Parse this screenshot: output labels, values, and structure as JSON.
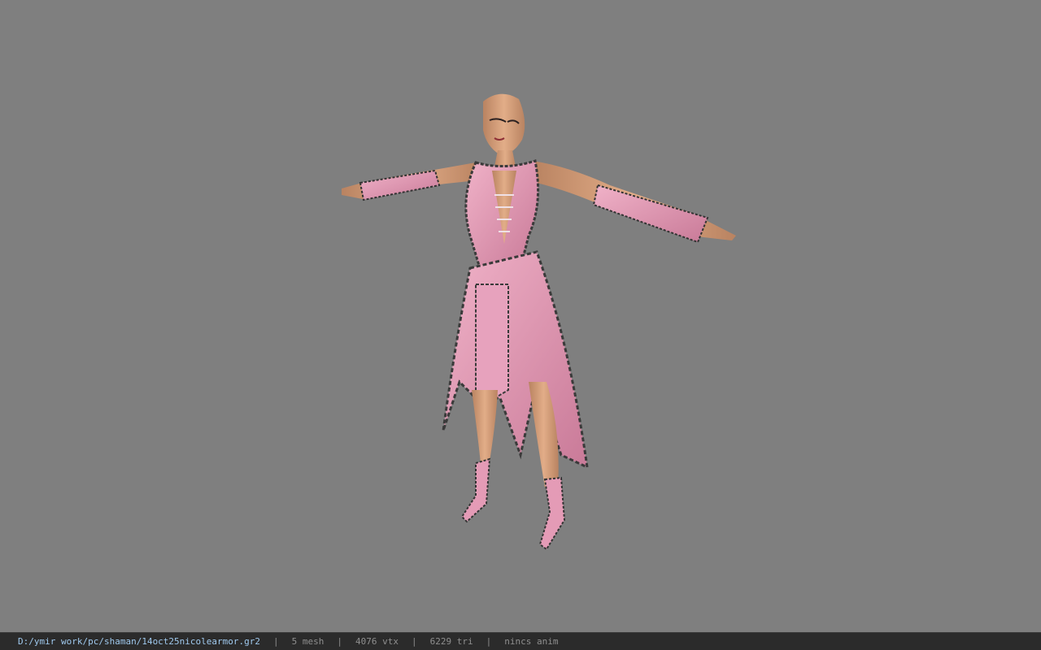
{
  "viewer": {
    "background_color": "#7f7f7f",
    "model": {
      "description_icon": "character-model-icon",
      "outfit_color": "#e49bb6",
      "trim_color": "#3a3a3a",
      "skin_color": "#d6a07a"
    }
  },
  "status_bar": {
    "file_path": "D:/ymir work/pc/shaman/14oct25nicolearmor.gr2",
    "separator": "|",
    "mesh_count": "5 mesh",
    "vertex_count": "4076 vtx",
    "triangle_count": "6229 tri",
    "anim_status": "nincs anim",
    "path_color": "#9fc9ee",
    "text_color": "#8f8f8f"
  }
}
